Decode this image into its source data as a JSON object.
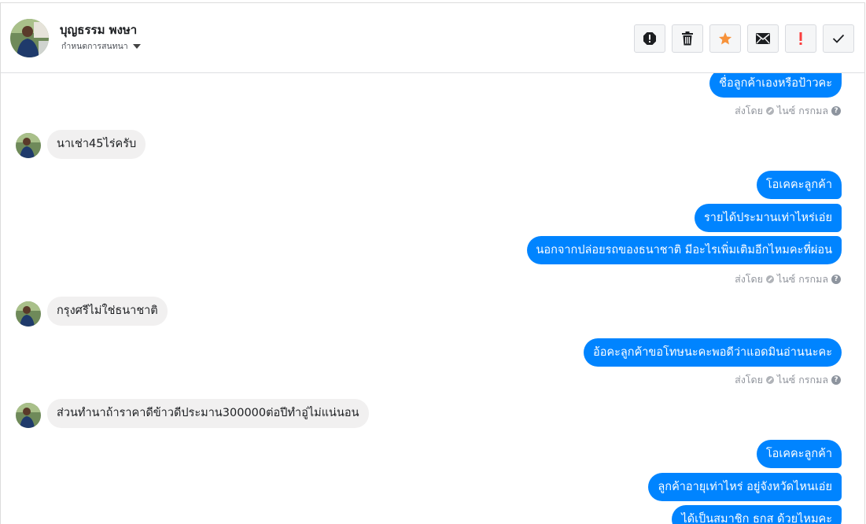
{
  "header": {
    "contact_name": "บุญธรรม พงษา",
    "assign_label": "กำหนดการสนทนา"
  },
  "toolbar": {
    "buttons": [
      {
        "name": "spam-button",
        "icon": "alert-octagon-icon"
      },
      {
        "name": "delete-button",
        "icon": "trash-icon"
      },
      {
        "name": "star-button",
        "icon": "star-icon",
        "color": "#f7923a"
      },
      {
        "name": "mark-unread-button",
        "icon": "envelope-icon"
      },
      {
        "name": "follow-up-button",
        "icon": "exclamation-icon",
        "color": "#fa3e3e"
      },
      {
        "name": "mark-done-button",
        "icon": "check-icon"
      }
    ]
  },
  "colors": {
    "outgoing_bubble": "#0084ff",
    "incoming_bubble": "#f1f0f0",
    "meta_text": "#90949c"
  },
  "messages": [
    {
      "dir": "out",
      "text": "ชื่อลูกค้าเองหรือป้าวคะ"
    },
    {
      "dir": "meta",
      "sent_label": "ส่งโดย",
      "sender": "ไนซ์ กรกมล"
    },
    {
      "dir": "in",
      "text": "นาเช่า45ไร่ครับ"
    },
    {
      "dir": "out",
      "text": "โอเคคะลูกค้า"
    },
    {
      "dir": "out",
      "text": "รายได้ประมานเท่าไหร่เอ่ย"
    },
    {
      "dir": "out",
      "text": "นอกจากปล่อยรถของธนาชาติ มีอะไรเพิ่มเติมอีกไหมคะที่ผ่อน"
    },
    {
      "dir": "meta",
      "sent_label": "ส่งโดย",
      "sender": "ไนซ์ กรกมล"
    },
    {
      "dir": "in",
      "text": "กรุงศรีไม่ใช่ธนาชาติ"
    },
    {
      "dir": "out",
      "text": "อ้อคะลูกค้าขอโทษนะคะพอดีว่าแอดมินอ่านนะคะ"
    },
    {
      "dir": "meta",
      "sent_label": "ส่งโดย",
      "sender": "ไนซ์ กรกมล"
    },
    {
      "dir": "in",
      "text": "ส่วนทำนาถ้าราคาดีข้าวดีประมาน300000ต่อปีทำอู่ไม่แน่นอน"
    },
    {
      "dir": "out",
      "text": "โอเคคะลูกค้า"
    },
    {
      "dir": "out",
      "text": "ลูกค้าอายุเท่าไหร่ อยู่จังหวัดไหนเอ่ย"
    },
    {
      "dir": "out",
      "text": "ได้เป็นสมาชิก ธกส ด้วยไหมคะ"
    }
  ]
}
